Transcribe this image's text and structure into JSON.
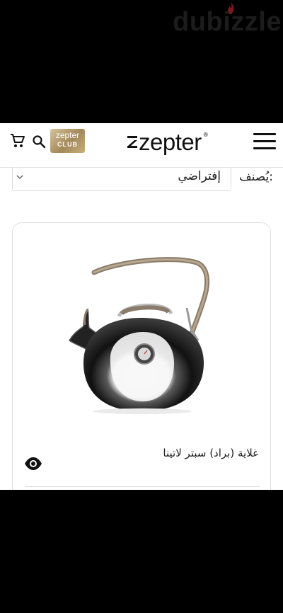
{
  "watermark": {
    "text": "dubizzle"
  },
  "header": {
    "logo_text": "zepter",
    "logo_reg": "®",
    "club_top": "zepter",
    "club_bottom": "CLUB"
  },
  "icons": {
    "menu": "hamburger-menu-icon",
    "search": "search-icon",
    "cart": "shopping-cart-icon",
    "quick_view": "eye-icon",
    "dropdown": "chevron-down-icon"
  },
  "sort": {
    "label": "يُصنف:",
    "value": "إفتراضي"
  },
  "product": {
    "name": "غلاية (براد) سبتر لاتينا"
  },
  "colors": {
    "background": "#000000",
    "text": "#111111",
    "club_gold": "#a4885a"
  }
}
